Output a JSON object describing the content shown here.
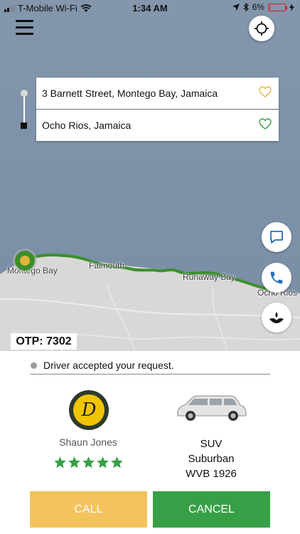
{
  "status_bar": {
    "carrier": "T-Mobile Wi-Fi",
    "time": "1:34 AM",
    "battery": "6%",
    "battery_level": 0.06
  },
  "map": {
    "origin_address": "3 Barnett Street, Montego Bay, Jamaica",
    "destination_address": "Ocho Rios, Jamaica",
    "labels": {
      "montego_bay": "Montego Bay",
      "falmouth": "Falmouth",
      "runaway_bay": "Runaway Bay",
      "ocho_rios": "Ocho Rios"
    },
    "otp": "OTP: 7302",
    "origin_heart_color": "#e8b84a",
    "destination_heart_color": "#3aa04a",
    "route_color": "#3b8f2c"
  },
  "trip": {
    "status_text": "Driver accepted your request.",
    "driver": {
      "name": "Shaun Jones",
      "avatar_letter": "D",
      "rating": 5,
      "rating_max": 5
    },
    "vehicle": {
      "type": "SUV",
      "model": "Suburban",
      "plate": "WVB 1926"
    }
  },
  "actions": {
    "call_label": "CALL",
    "cancel_label": "CANCEL",
    "call_color": "#f3c35c",
    "cancel_color": "#37a046"
  },
  "icons": {
    "menu": "hamburger-icon",
    "locate": "crosshair-icon",
    "chat": "chat-bubble-icon",
    "phone": "phone-icon",
    "share": "share-trip-icon",
    "favorite": "heart-icon",
    "star": "star-icon"
  }
}
